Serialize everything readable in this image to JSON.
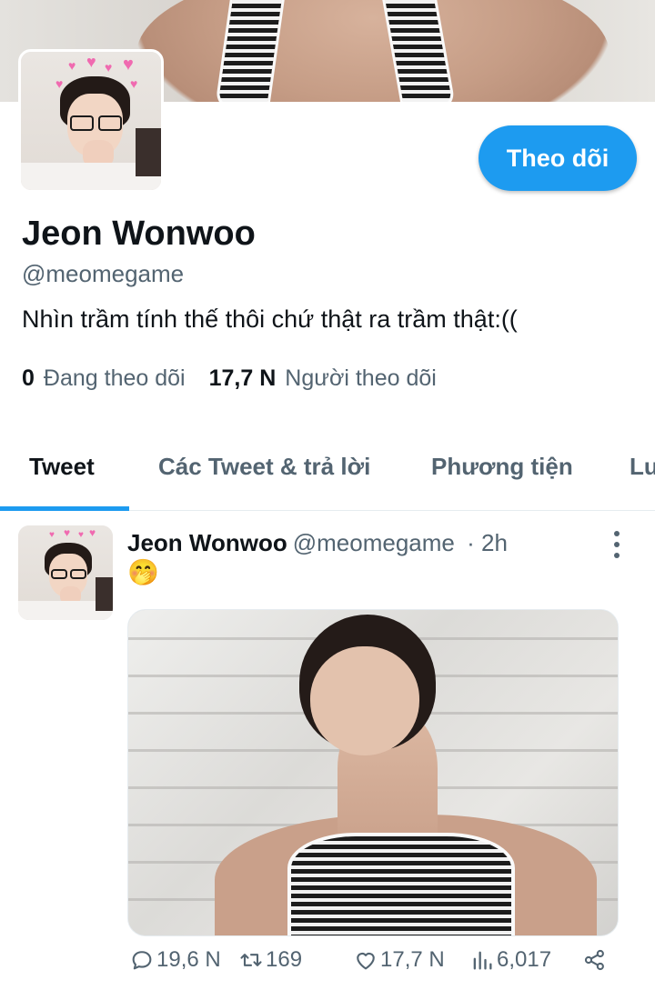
{
  "profile": {
    "display_name": "Jeon Wonwoo",
    "handle": "@meomegame",
    "bio": "Nhìn trầm tính thế thôi chứ thật ra trầm thật:((",
    "follow_label": "Theo dõi",
    "following_count": "0",
    "following_label": "Đang theo dõi",
    "followers_count": "17,7 N",
    "followers_label": "Người theo dõi"
  },
  "tabs": [
    {
      "label": "Tweet",
      "active": true
    },
    {
      "label": "Các Tweet & trả lời",
      "active": false
    },
    {
      "label": "Phương tiện",
      "active": false
    },
    {
      "label": "Lu",
      "active": false
    }
  ],
  "tweet": {
    "author_name": "Jeon Wonwoo",
    "author_handle": "@meomegame",
    "time": "· 2h",
    "text": "🤭",
    "actions": {
      "replies": "19,6 N",
      "retweets": "169",
      "likes": "17,7 N",
      "views": "6,017"
    }
  },
  "colors": {
    "accent": "#1d9bf0",
    "text_primary": "#0f1419",
    "text_secondary": "#536471"
  }
}
